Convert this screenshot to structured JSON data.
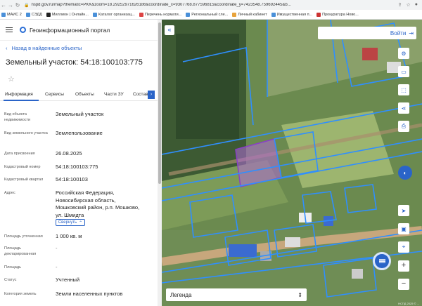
{
  "browser": {
    "url": "nspd.gov.ru/map?thematic=PKK&zoom=18.29252971626186&coordinate_x=9307768.877596815&coordinate_y=7423548.759692445&b...",
    "bookmarks": [
      "МАИС 2",
      "СЭДД",
      "Миллион | Онлайн...",
      "Каталог организац...",
      "Перечень нормати...",
      "Региональный сле...",
      "Личный кабинет",
      "Имущественная п...",
      "Прокуратура Ново..."
    ]
  },
  "portal": {
    "title": "Геоинформационный портал"
  },
  "back_link": "Назад в найденные объекты",
  "object_title": "Земельный участок: 54:18:100103:775",
  "tabs": [
    "Информация",
    "Сервисы",
    "Объекты",
    "Части ЗУ",
    "Состав"
  ],
  "rows": [
    {
      "label": "Вид объекта недвижимости",
      "value": "Земельный участок"
    },
    {
      "label": "Вид земельного участка",
      "value": "Землепользование"
    },
    {
      "label": "Дата присвоения",
      "value": "26.08.2025"
    },
    {
      "label": "Кадастровый номер",
      "value": "54:18:100103:775"
    },
    {
      "label": "Кадастровый квартал",
      "value": "54:18:100103"
    },
    {
      "label": "Адрес",
      "value": "Российская Федерация, Новосибирская область, Мошковский район, р.п. Мошково, ул. Шмидта"
    },
    {
      "label": "Площадь уточненная",
      "value": "1 000 кв. м"
    },
    {
      "label": "Площадь декларированная",
      "value": "-"
    },
    {
      "label": "Площадь",
      "value": "-"
    },
    {
      "label": "Статус",
      "value": "Учтенный"
    },
    {
      "label": "Категория земель",
      "value": "Земли населенных пунктов"
    }
  ],
  "collapse_label": "Свернуть",
  "map": {
    "login_label": "Войти",
    "legend_label": "Легенда",
    "copyright": "НСПД 2025 © ...",
    "colors": {
      "boundary": "#2f8fff",
      "selected_fill": "#b06ad8",
      "accent": "#2a64c8"
    }
  }
}
